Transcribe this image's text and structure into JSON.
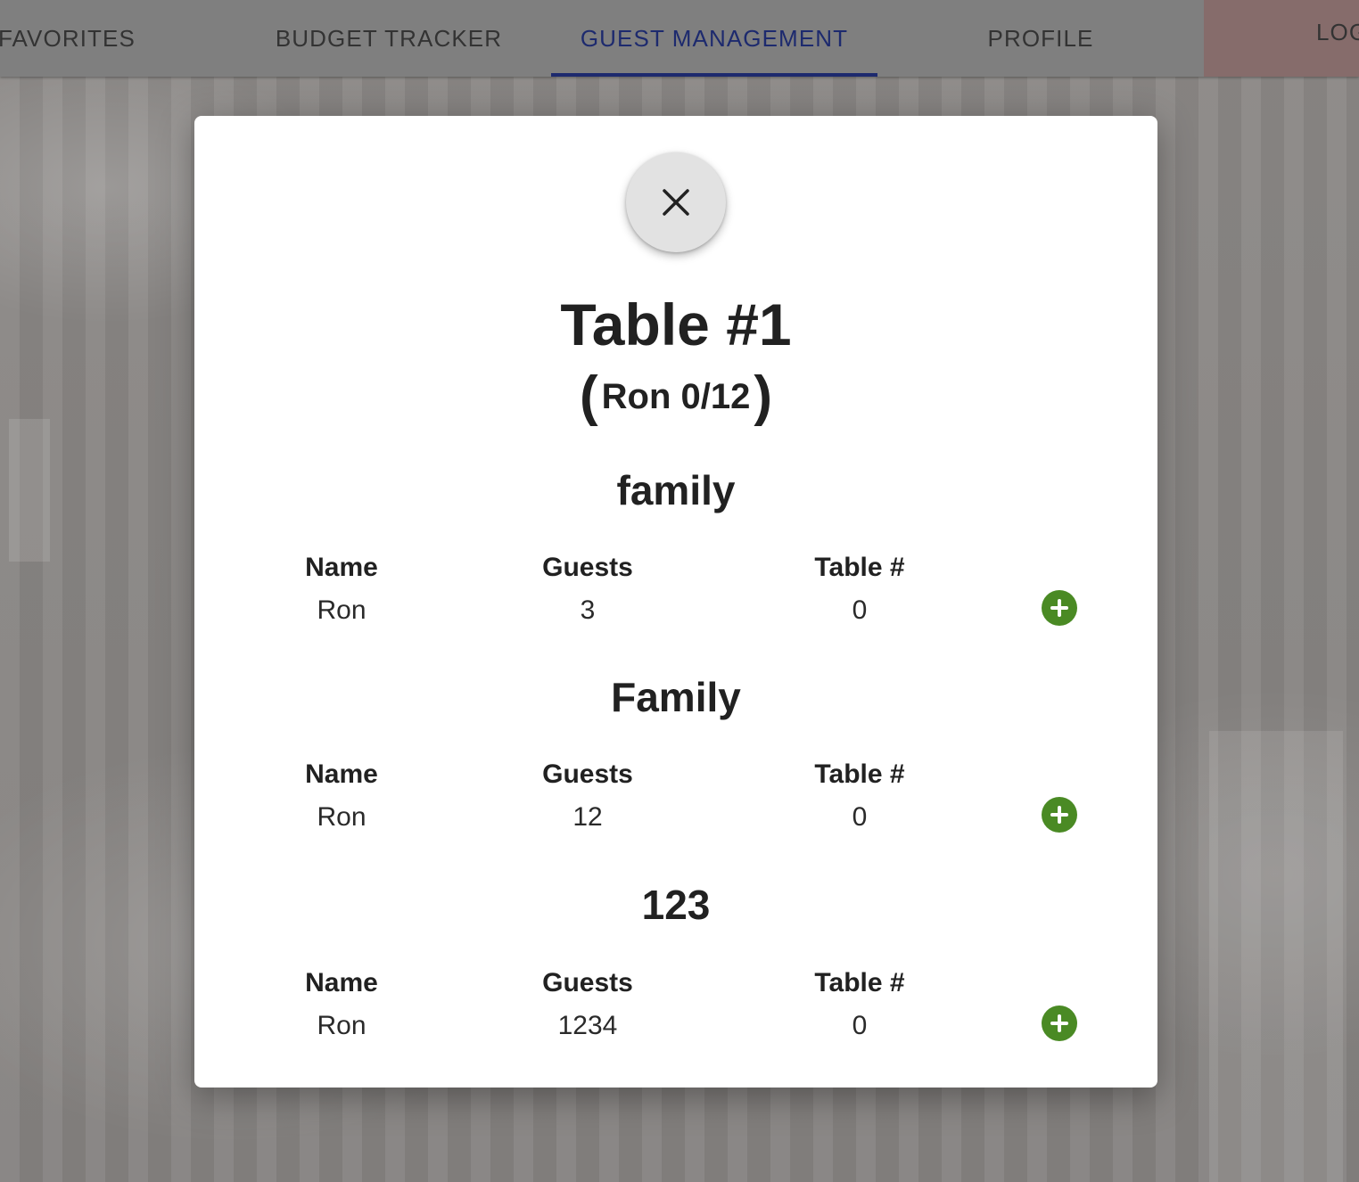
{
  "nav": {
    "items": [
      {
        "label": "FAVORITES"
      },
      {
        "label": "BUDGET TRACKER"
      },
      {
        "label": "GUEST MANAGEMENT",
        "active": true
      },
      {
        "label": "PROFILE"
      }
    ],
    "logout_label": "LOG",
    "active_color": "#1d2a6e"
  },
  "modal": {
    "close_icon": "close-icon",
    "title": "Table #1",
    "subtitle_open": "(",
    "subtitle_text": "Ron 0/12",
    "subtitle_close": ")",
    "groups": [
      {
        "title": "family",
        "headers": {
          "name": "Name",
          "guests": "Guests",
          "table": "Table #"
        },
        "row": {
          "name": "Ron",
          "guests": "3",
          "table": "0"
        },
        "add_icon": "plus-circle-icon"
      },
      {
        "title": "Family",
        "headers": {
          "name": "Name",
          "guests": "Guests",
          "table": "Table #"
        },
        "row": {
          "name": "Ron",
          "guests": "12",
          "table": "0"
        },
        "add_icon": "plus-circle-icon"
      },
      {
        "title": "123",
        "headers": {
          "name": "Name",
          "guests": "Guests",
          "table": "Table #"
        },
        "row": {
          "name": "Ron",
          "guests": "1234",
          "table": "0"
        },
        "add_icon": "plus-circle-icon"
      }
    ],
    "add_button_color": "#4a8a24"
  }
}
